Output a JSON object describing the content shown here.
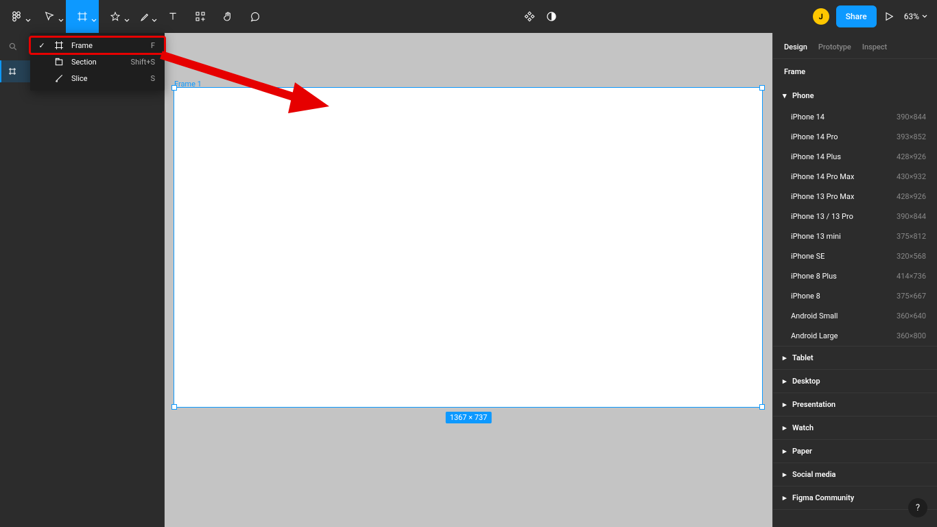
{
  "toolbar": {
    "zoom_label": "63%",
    "share_label": "Share",
    "avatar_letter": "J"
  },
  "dropdown": {
    "items": [
      {
        "label": "Frame",
        "shortcut": "F",
        "checked": true
      },
      {
        "label": "Section",
        "shortcut": "Shift+S",
        "checked": false
      },
      {
        "label": "Slice",
        "shortcut": "S",
        "checked": false
      }
    ]
  },
  "canvas": {
    "frame_label": "Frame 1",
    "dimensions_label": "1367 × 737"
  },
  "right_panel": {
    "tabs": [
      "Design",
      "Prototype",
      "Inspect"
    ],
    "heading": "Frame",
    "phone_group": "Phone",
    "presets": [
      {
        "name": "iPhone 14",
        "dim": "390×844"
      },
      {
        "name": "iPhone 14 Pro",
        "dim": "393×852"
      },
      {
        "name": "iPhone 14 Plus",
        "dim": "428×926"
      },
      {
        "name": "iPhone 14 Pro Max",
        "dim": "430×932"
      },
      {
        "name": "iPhone 13 Pro Max",
        "dim": "428×926"
      },
      {
        "name": "iPhone 13 / 13 Pro",
        "dim": "390×844"
      },
      {
        "name": "iPhone 13 mini",
        "dim": "375×812"
      },
      {
        "name": "iPhone SE",
        "dim": "320×568"
      },
      {
        "name": "iPhone 8 Plus",
        "dim": "414×736"
      },
      {
        "name": "iPhone 8",
        "dim": "375×667"
      },
      {
        "name": "Android Small",
        "dim": "360×640"
      },
      {
        "name": "Android Large",
        "dim": "360×800"
      }
    ],
    "collapsed_groups": [
      "Tablet",
      "Desktop",
      "Presentation",
      "Watch",
      "Paper",
      "Social media",
      "Figma Community"
    ]
  },
  "help_label": "?"
}
